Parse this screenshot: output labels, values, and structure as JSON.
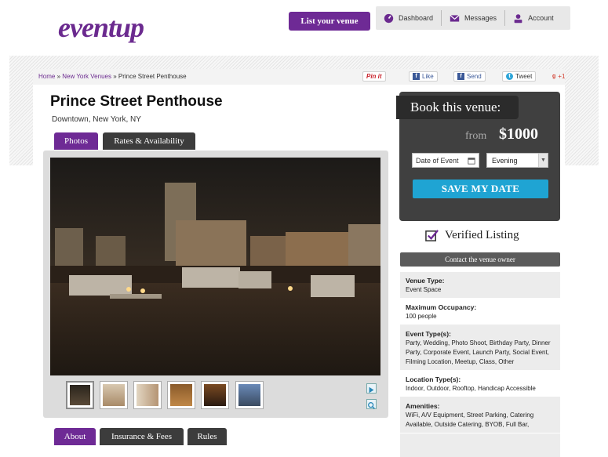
{
  "header": {
    "logo": "eventup",
    "list_venue": "List your venue",
    "nav": [
      {
        "label": "Dashboard",
        "icon": "dashboard-icon"
      },
      {
        "label": "Messages",
        "icon": "envelope-icon"
      },
      {
        "label": "Account",
        "icon": "user-icon"
      }
    ]
  },
  "breadcrumb": {
    "home": "Home",
    "sep1": " » ",
    "city": "New York Venues",
    "sep2": " » ",
    "current": "Prince Street Penthouse"
  },
  "share": {
    "pinit": "Pin it",
    "like": "Like",
    "send": "Send",
    "tweet": "Tweet",
    "gplus": "+1"
  },
  "venue": {
    "title": "Prince Street Penthouse",
    "location": "Downtown, New York, NY"
  },
  "tabs": {
    "photos": "Photos",
    "rates": "Rates & Availability"
  },
  "booking": {
    "heading": "Book this venue:",
    "from": "from",
    "price": "$1000",
    "date_placeholder": "Date of Event",
    "time_value": "Evening",
    "save_label": "SAVE MY DATE"
  },
  "verified": "Verified Listing",
  "contact": "Contact the venue owner",
  "details": [
    {
      "label": "Venue Type:",
      "value": "Event Space"
    },
    {
      "label": "Maximum Occupancy:",
      "value": "100 people"
    },
    {
      "label": "Event Type(s):",
      "value": "Party, Wedding, Photo Shoot, Birthday Party, Dinner Party, Corporate Event, Launch Party, Social Event, Filming Location, Meetup, Class, Other"
    },
    {
      "label": "Location Type(s):",
      "value": "Indoor, Outdoor, Rooftop, Handicap Accessible"
    },
    {
      "label": "Amenities:",
      "value": "WiFi, A/V Equipment, Street Parking, Catering Available, Outside Catering, BYOB, Full Bar,"
    }
  ],
  "bottom_tabs": {
    "about": "About",
    "insurance": "Insurance & Fees",
    "rules": "Rules"
  },
  "colors": {
    "brand_purple": "#6e2a95",
    "cta_blue": "#1fa4d3",
    "dark_panel": "#404040"
  }
}
